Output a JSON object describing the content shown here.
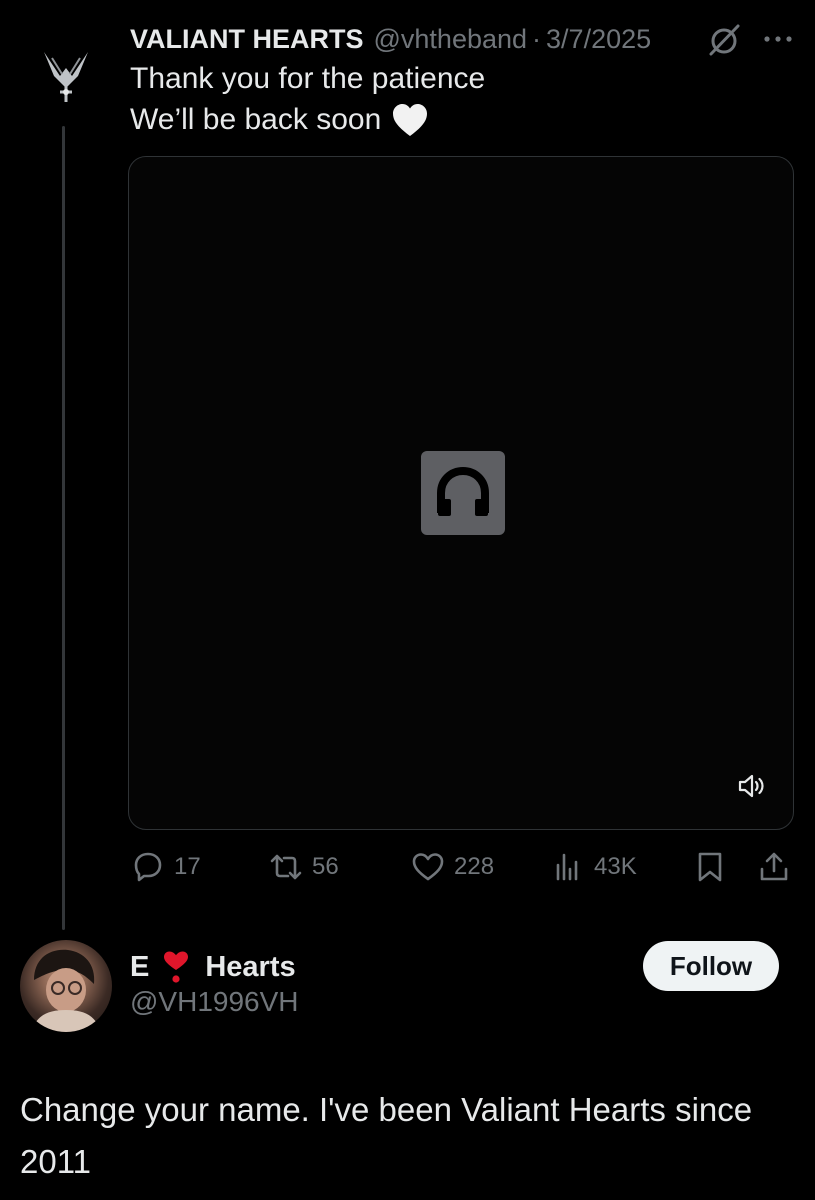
{
  "quoted_tweet": {
    "display_name": "VALIANT HEARTS",
    "handle": "@vhtheband",
    "separator": "·",
    "date": "3/7/2025",
    "text_line_1": "Thank you for the patience",
    "text_line_2": "We’ll be back soon",
    "emoji": "white-heart",
    "media": {
      "type": "video",
      "placeholder_icon": "headphones-icon",
      "control_icon": "volume-icon"
    },
    "actions": {
      "replies": "17",
      "reposts": "56",
      "likes": "228",
      "views": "43K"
    }
  },
  "reply_tweet": {
    "display_name_prefix": "E",
    "display_name_suffix": "Hearts",
    "name_emoji": "red-heart-exclamation",
    "handle": "@VH1996VH",
    "follow_label": "Follow",
    "text": "Change your name. I've been Valiant Hearts since 2011"
  },
  "colors": {
    "background": "#000000",
    "primary_text": "#e7e9ea",
    "secondary_text": "#71767b",
    "follow_button_bg": "#eff3f4",
    "follow_button_text": "#0f1419",
    "heart_red": "#e0162b"
  }
}
